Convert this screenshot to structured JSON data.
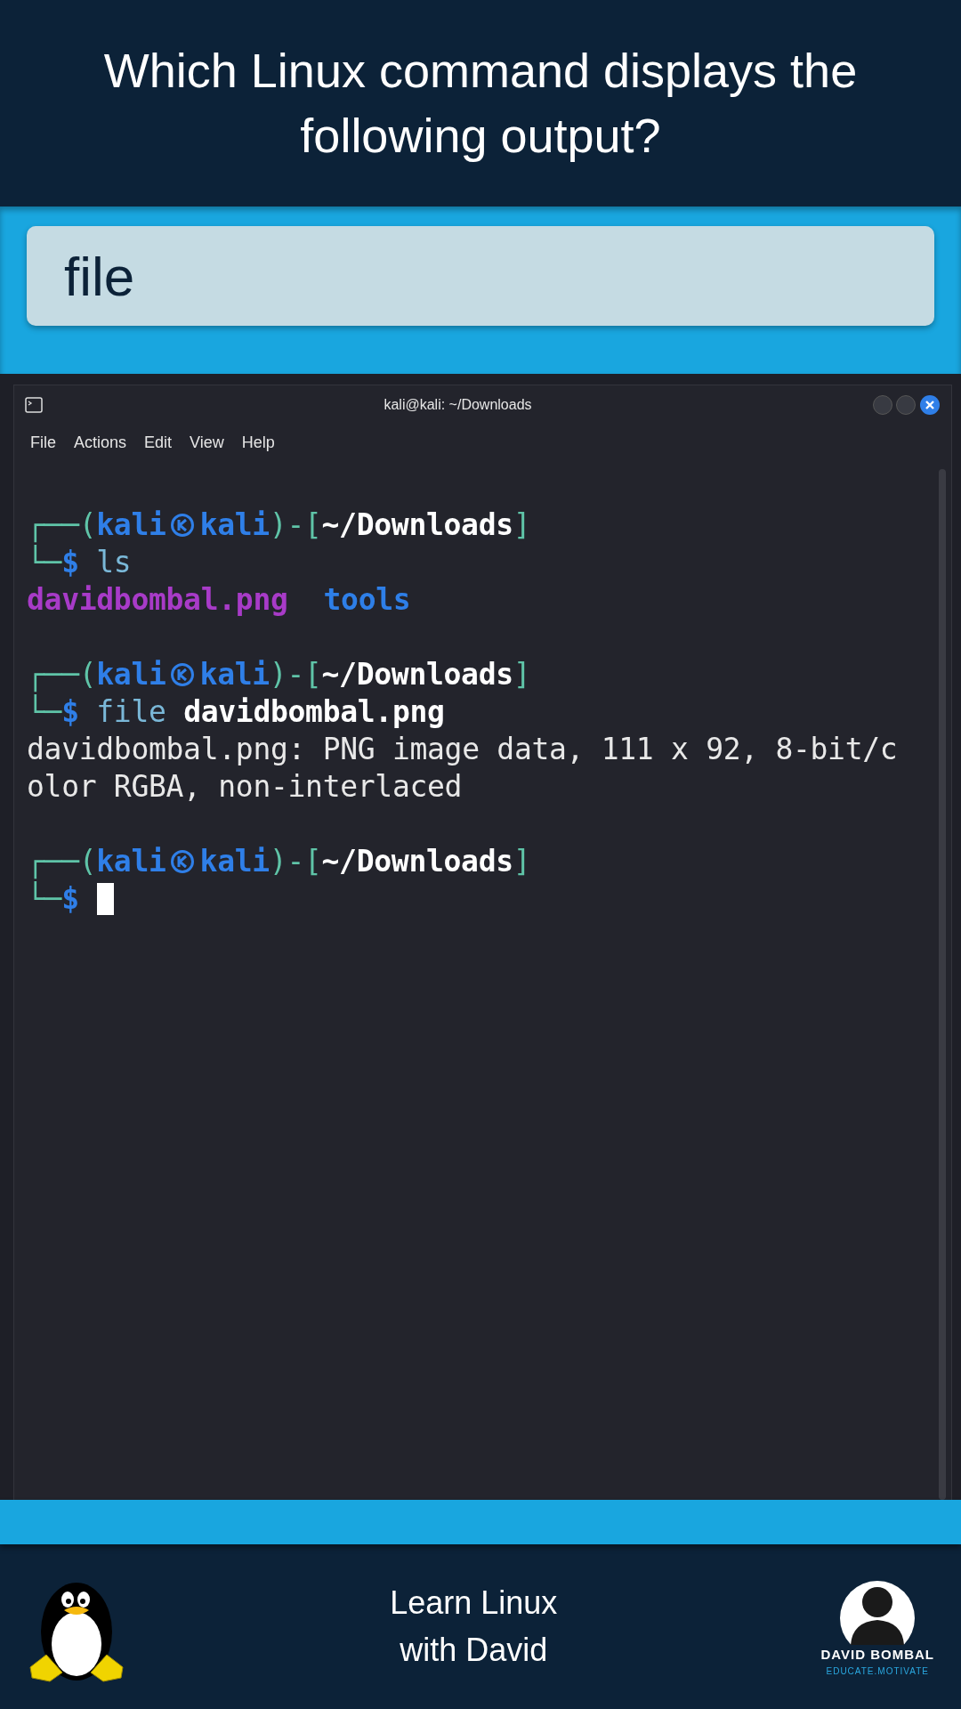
{
  "question": "Which Linux command displays the following output?",
  "answer": "file",
  "terminal": {
    "title": "kali@kali: ~/Downloads",
    "menu": [
      "File",
      "Actions",
      "Edit",
      "View",
      "Help"
    ],
    "lines": [
      {
        "kind": "blank"
      },
      {
        "kind": "prompt",
        "open": "┌──(",
        "user": "kali",
        "host": "kali",
        "sep": ")-[",
        "path": "~/Downloads",
        "close": "]",
        "corner": "└─",
        "dollar": "$",
        "command": "ls",
        "cursor": false
      },
      {
        "kind": "listing",
        "entries": [
          {
            "text": "davidbombal.png",
            "color": "#a83bc8"
          },
          {
            "text": "tools",
            "color": "#2e7fe8"
          }
        ]
      },
      {
        "kind": "blank"
      },
      {
        "kind": "prompt",
        "open": "┌──(",
        "user": "kali",
        "host": "kali",
        "sep": ")-[",
        "path": "~/Downloads",
        "close": "]",
        "corner": "└─",
        "dollar": "$",
        "command": "file",
        "argument": "davidbombal.png",
        "cursor": false
      },
      {
        "kind": "output",
        "text": "davidbombal.png: PNG image data, 111 x 92, 8-bit/c"
      },
      {
        "kind": "output",
        "text": "olor RGBA, non-interlaced"
      },
      {
        "kind": "blank"
      },
      {
        "kind": "prompt",
        "open": "┌──(",
        "user": "kali",
        "host": "kali",
        "sep": ")-[",
        "path": "~/Downloads",
        "close": "]",
        "corner": "└─",
        "dollar": "$",
        "cursor": true
      }
    ]
  },
  "footer": {
    "lines": [
      "Learn Linux",
      "with David"
    ],
    "logo": {
      "name": "DAVID BOMBAL",
      "tagline": "EDUCATE.MOTIVATE"
    }
  }
}
